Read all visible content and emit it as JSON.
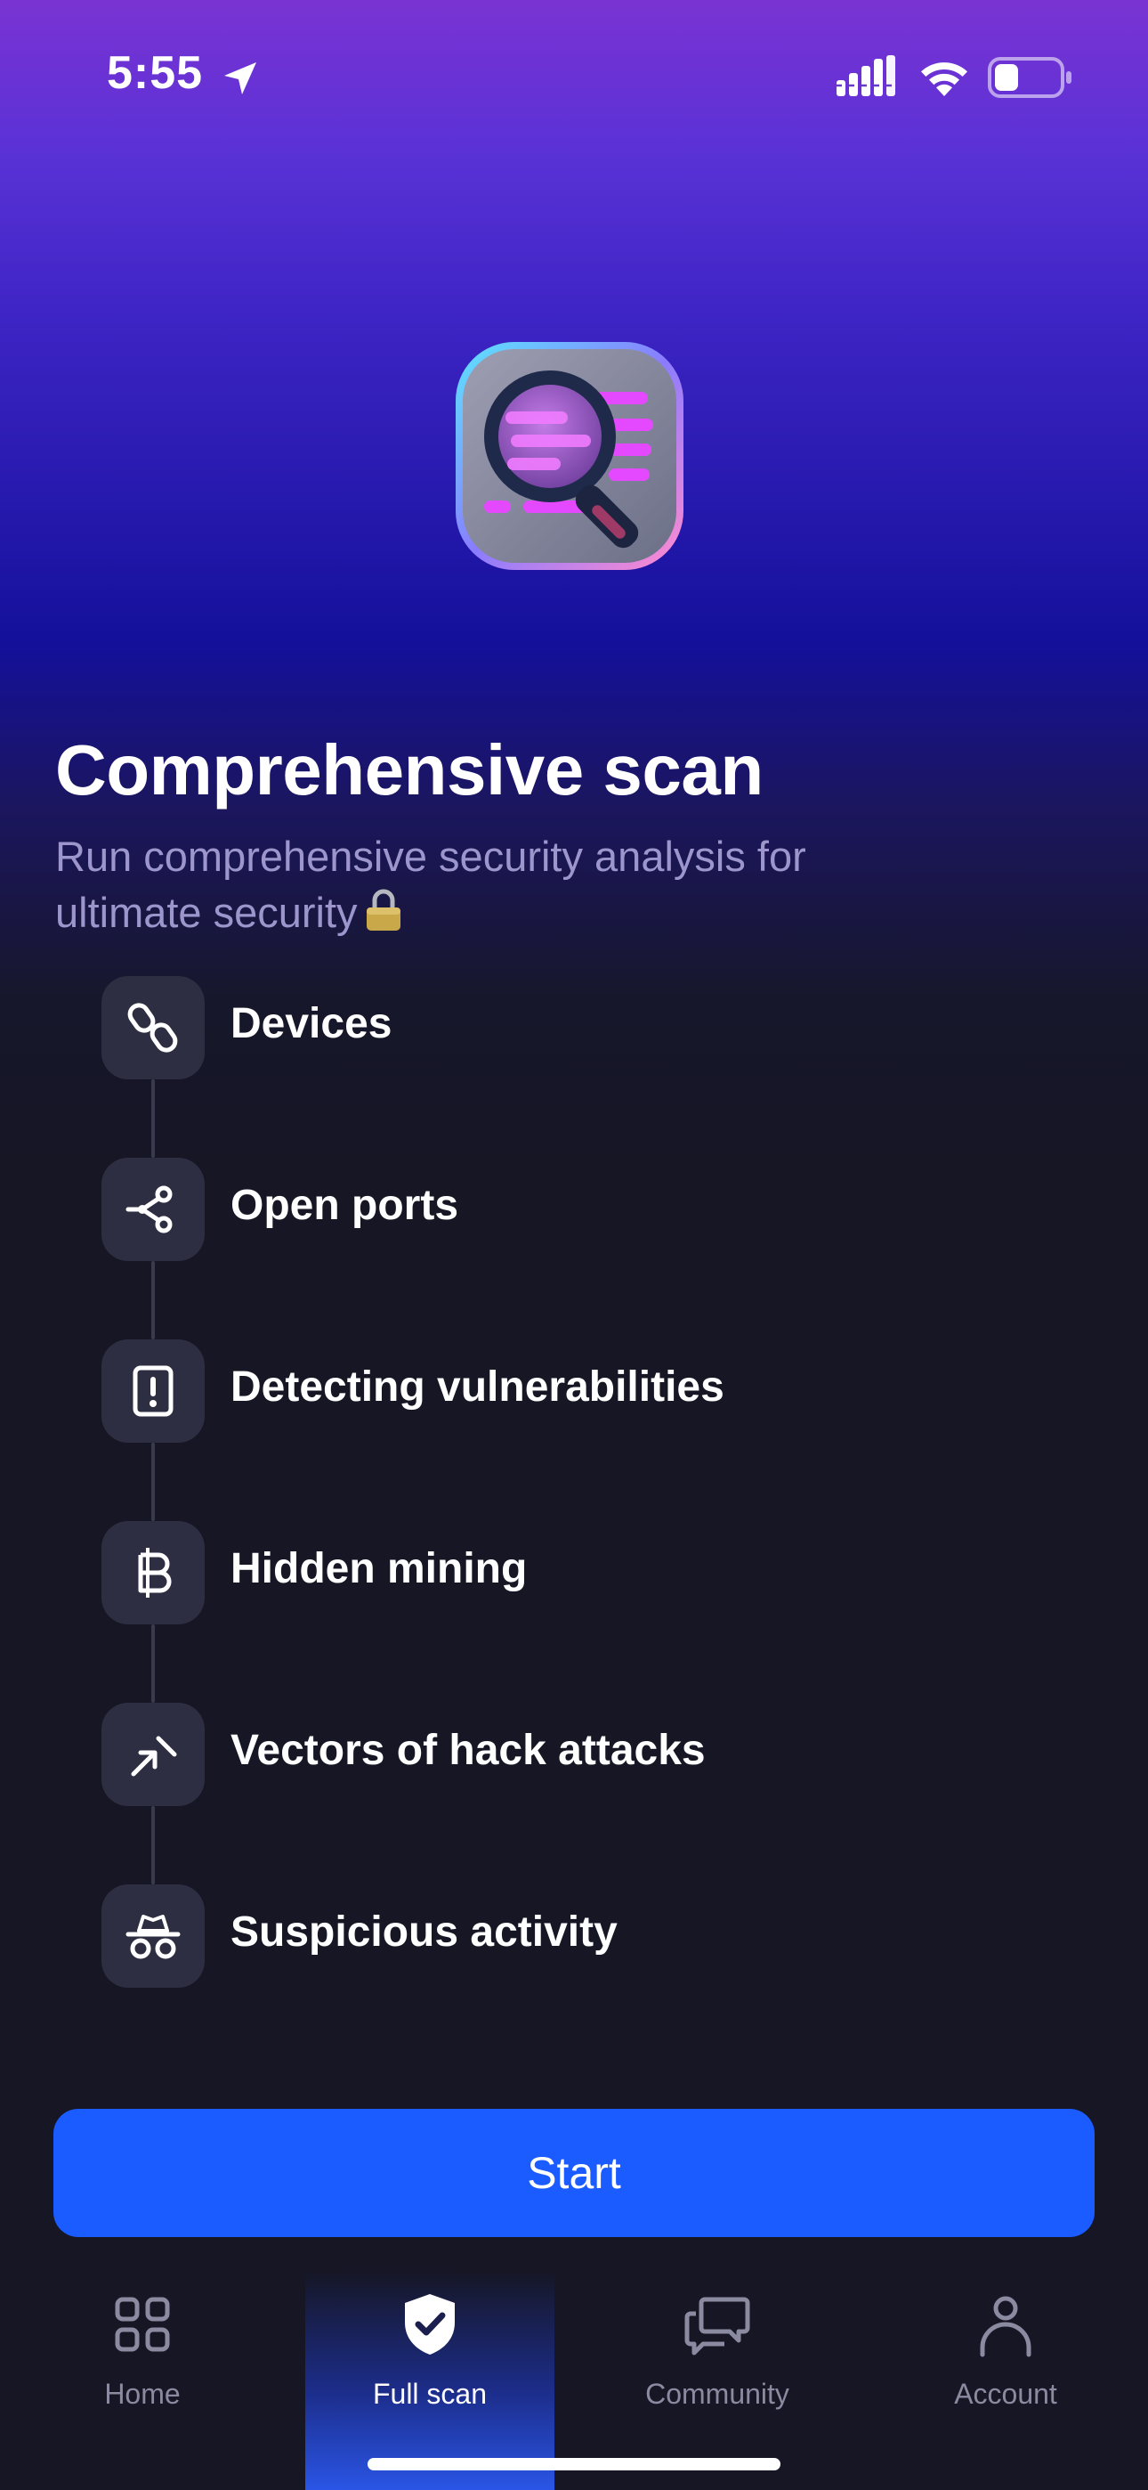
{
  "status_bar": {
    "time": "5:55",
    "icons": [
      "location-arrow-icon",
      "cellular-signal-icon",
      "wifi-icon",
      "battery-icon"
    ]
  },
  "hero": {
    "icon": "magnifier-document-icon"
  },
  "header": {
    "title": "Comprehensive scan",
    "subtitle": "Run comprehensive security analysis for ultimate security",
    "subtitle_emoji": "lock-emoji-icon"
  },
  "checklist": {
    "items": [
      {
        "label": "Devices",
        "icon": "chain-link-icon"
      },
      {
        "label": "Open ports",
        "icon": "share-nodes-icon"
      },
      {
        "label": "Detecting vulnerabilities",
        "icon": "exclamation-box-icon"
      },
      {
        "label": "Hidden mining",
        "icon": "baht-coin-icon"
      },
      {
        "label": "Vectors of hack attacks",
        "icon": "attack-vector-icon"
      },
      {
        "label": "Suspicious activity",
        "icon": "incognito-spy-icon"
      }
    ]
  },
  "actions": {
    "start_label": "Start"
  },
  "tab_bar": {
    "tabs": [
      {
        "label": "Home",
        "icon": "grid-icon",
        "active": false
      },
      {
        "label": "Full scan",
        "icon": "shield-check-icon",
        "active": true
      },
      {
        "label": "Community",
        "icon": "chat-bubbles-icon",
        "active": false
      },
      {
        "label": "Account",
        "icon": "person-icon",
        "active": false
      }
    ]
  },
  "colors": {
    "accent": "#1a5cff",
    "background": "#161625",
    "gradient_top": "#7a33d3",
    "gradient_mid": "#14109b",
    "tile": "#2e2e42",
    "subtitle": "#9c96cc",
    "inactive_tab": "#8a8aa0"
  }
}
